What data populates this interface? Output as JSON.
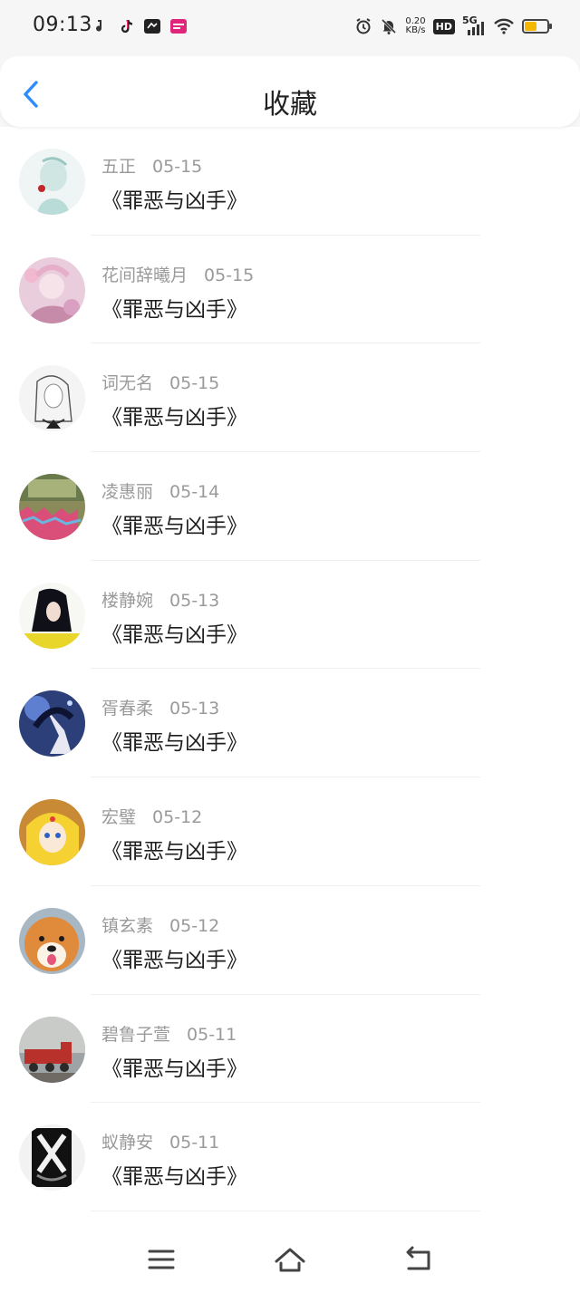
{
  "status_bar": {
    "time": "09:13",
    "net_speed_value": "0.20",
    "net_speed_unit": "KB/s",
    "hd_label": "HD",
    "network_label": "5G",
    "battery_level": 0.55,
    "battery_color": "#f5b800"
  },
  "header": {
    "title": "收藏",
    "back_icon": "chevron-left-icon",
    "accent_color": "#2e8bff"
  },
  "items": [
    {
      "name": "五正",
      "date": "05-15",
      "title": "《罪恶与凶手》"
    },
    {
      "name": "花间辞曦月",
      "date": "05-15",
      "title": "《罪恶与凶手》"
    },
    {
      "name": "词无名",
      "date": "05-15",
      "title": "《罪恶与凶手》"
    },
    {
      "name": "凌惠丽",
      "date": "05-14",
      "title": "《罪恶与凶手》"
    },
    {
      "name": "楼静婉",
      "date": "05-13",
      "title": "《罪恶与凶手》"
    },
    {
      "name": "胥春柔",
      "date": "05-13",
      "title": "《罪恶与凶手》"
    },
    {
      "name": "宏璧",
      "date": "05-12",
      "title": "《罪恶与凶手》"
    },
    {
      "name": "镇玄素",
      "date": "05-12",
      "title": "《罪恶与凶手》"
    },
    {
      "name": "碧鲁子萱",
      "date": "05-11",
      "title": "《罪恶与凶手》"
    },
    {
      "name": "蚁静安",
      "date": "05-11",
      "title": "《罪恶与凶手》"
    }
  ],
  "bottom_nav": {
    "menu_icon": "menu-icon",
    "home_icon": "home-icon",
    "back_icon": "back-arrow-icon"
  }
}
